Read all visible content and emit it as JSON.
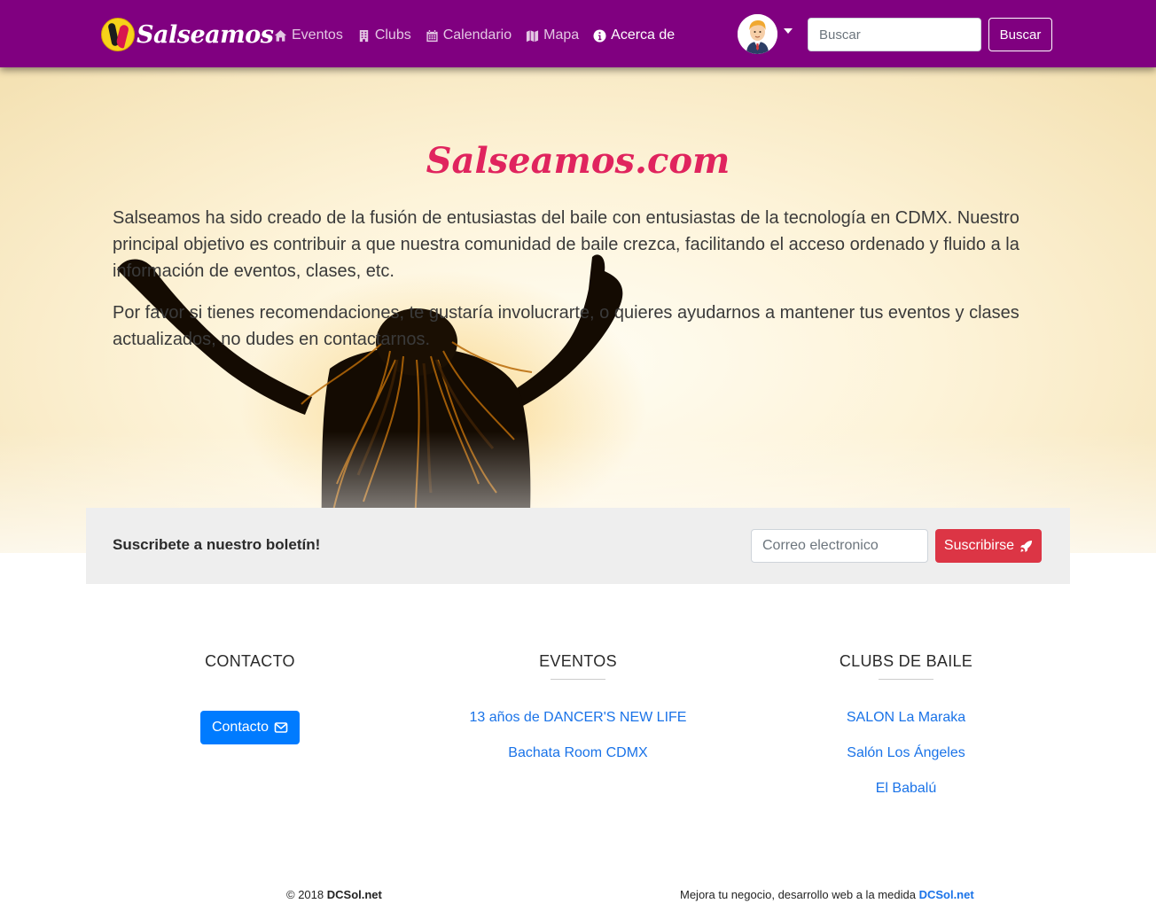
{
  "nav": {
    "brand": "Salseamos",
    "items": [
      {
        "label": "Eventos",
        "icon": "home-icon"
      },
      {
        "label": "Clubs",
        "icon": "building-icon"
      },
      {
        "label": "Calendario",
        "icon": "calendar-icon"
      },
      {
        "label": "Mapa",
        "icon": "map-icon"
      },
      {
        "label": "Acerca de",
        "icon": "info-icon",
        "active": true
      }
    ],
    "search_placeholder": "Buscar",
    "search_button": "Buscar",
    "color": "#800080"
  },
  "hero": {
    "title": "Salseamos.com",
    "paragraph1": "Salseamos ha sido creado de la fusión de entusiastas del baile con entusiastas de la tecnología en CDMX. Nuestro principal objetivo es contribuir a que nuestra comunidad de baile crezca, facilitando el acceso ordenado y fluido a la información de eventos, clases, etc.",
    "paragraph2": "Por favor si tienes recomendaciones, te gustaría involucrarte, o quieres ayudarnos a mantener tus eventos y clases actualizados, no dudes en contactarnos.",
    "title_color": "#e0245e"
  },
  "newsletter": {
    "label": "Suscribete a nuestro boletín!",
    "email_placeholder": "Correo electronico",
    "button": "Suscribirse",
    "button_icon": "rocket-icon"
  },
  "footer": {
    "contact": {
      "heading": "CONTACTO",
      "button": "Contacto",
      "button_icon": "envelope-icon"
    },
    "events": {
      "heading": "EVENTOS",
      "links": [
        "13 años de DANCER'S NEW LIFE",
        "Bachata Room CDMX"
      ]
    },
    "clubs": {
      "heading": "CLUBS DE BAILE",
      "links": [
        "SALON La Maraka",
        "Salón Los Ángeles",
        "El Babalú"
      ]
    },
    "copyright_prefix": "© 2018",
    "copyright_brand": "DCSol.net",
    "tagline_prefix": "Mejora tu negocio, desarrollo web a la medida",
    "tagline_brand": "DCSol.net"
  }
}
